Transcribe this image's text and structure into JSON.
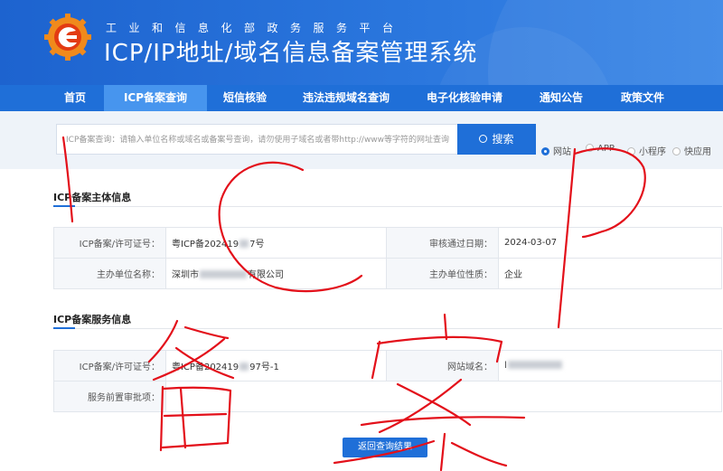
{
  "header": {
    "subtitle": "工业和信息化部政务服务平台",
    "title": "ICP/IP地址/域名信息备案管理系统"
  },
  "nav": {
    "items": [
      {
        "label": "首页"
      },
      {
        "label": "ICP备案查询"
      },
      {
        "label": "短信核验"
      },
      {
        "label": "违法违规域名查询"
      },
      {
        "label": "电子化核验申请"
      },
      {
        "label": "通知公告"
      },
      {
        "label": "政策文件"
      }
    ],
    "active_index": 1
  },
  "search": {
    "placeholder": "ICP备案查询：请输入单位名称或域名或备案号查询，请勿使用子域名或者带http://www等字符的网址查询",
    "button_label": "搜索",
    "options": [
      {
        "label": "网站",
        "selected": true
      },
      {
        "label": "APP",
        "selected": false
      },
      {
        "label": "小程序",
        "selected": false
      },
      {
        "label": "快应用",
        "selected": false
      }
    ]
  },
  "subject_info": {
    "title": "ICP备案主体信息",
    "license_label": "ICP备案/许可证号：",
    "license_prefix": "粤ICP备202419",
    "license_suffix": "7号",
    "approve_date_label": "审核通过日期：",
    "approve_date": "2024-03-07",
    "org_name_label": "主办单位名称：",
    "org_name_prefix": "深圳市",
    "org_name_suffix": "有限公司",
    "org_type_label": "主办单位性质：",
    "org_type": "企业"
  },
  "service_info": {
    "title": "ICP备案服务信息",
    "license_label": "ICP备案/许可证号：",
    "license_prefix": "粤ICP备202419",
    "license_suffix": "97号-1",
    "domain_label": "网站域名：",
    "domain_prefix": "l",
    "preapproval_label": "服务前置审批项："
  },
  "back_button_label": "返回查询结果",
  "colors": {
    "brand_blue": "#1f6fd8",
    "nav_active": "#4795ee",
    "annotation_red": "#e3101a"
  }
}
